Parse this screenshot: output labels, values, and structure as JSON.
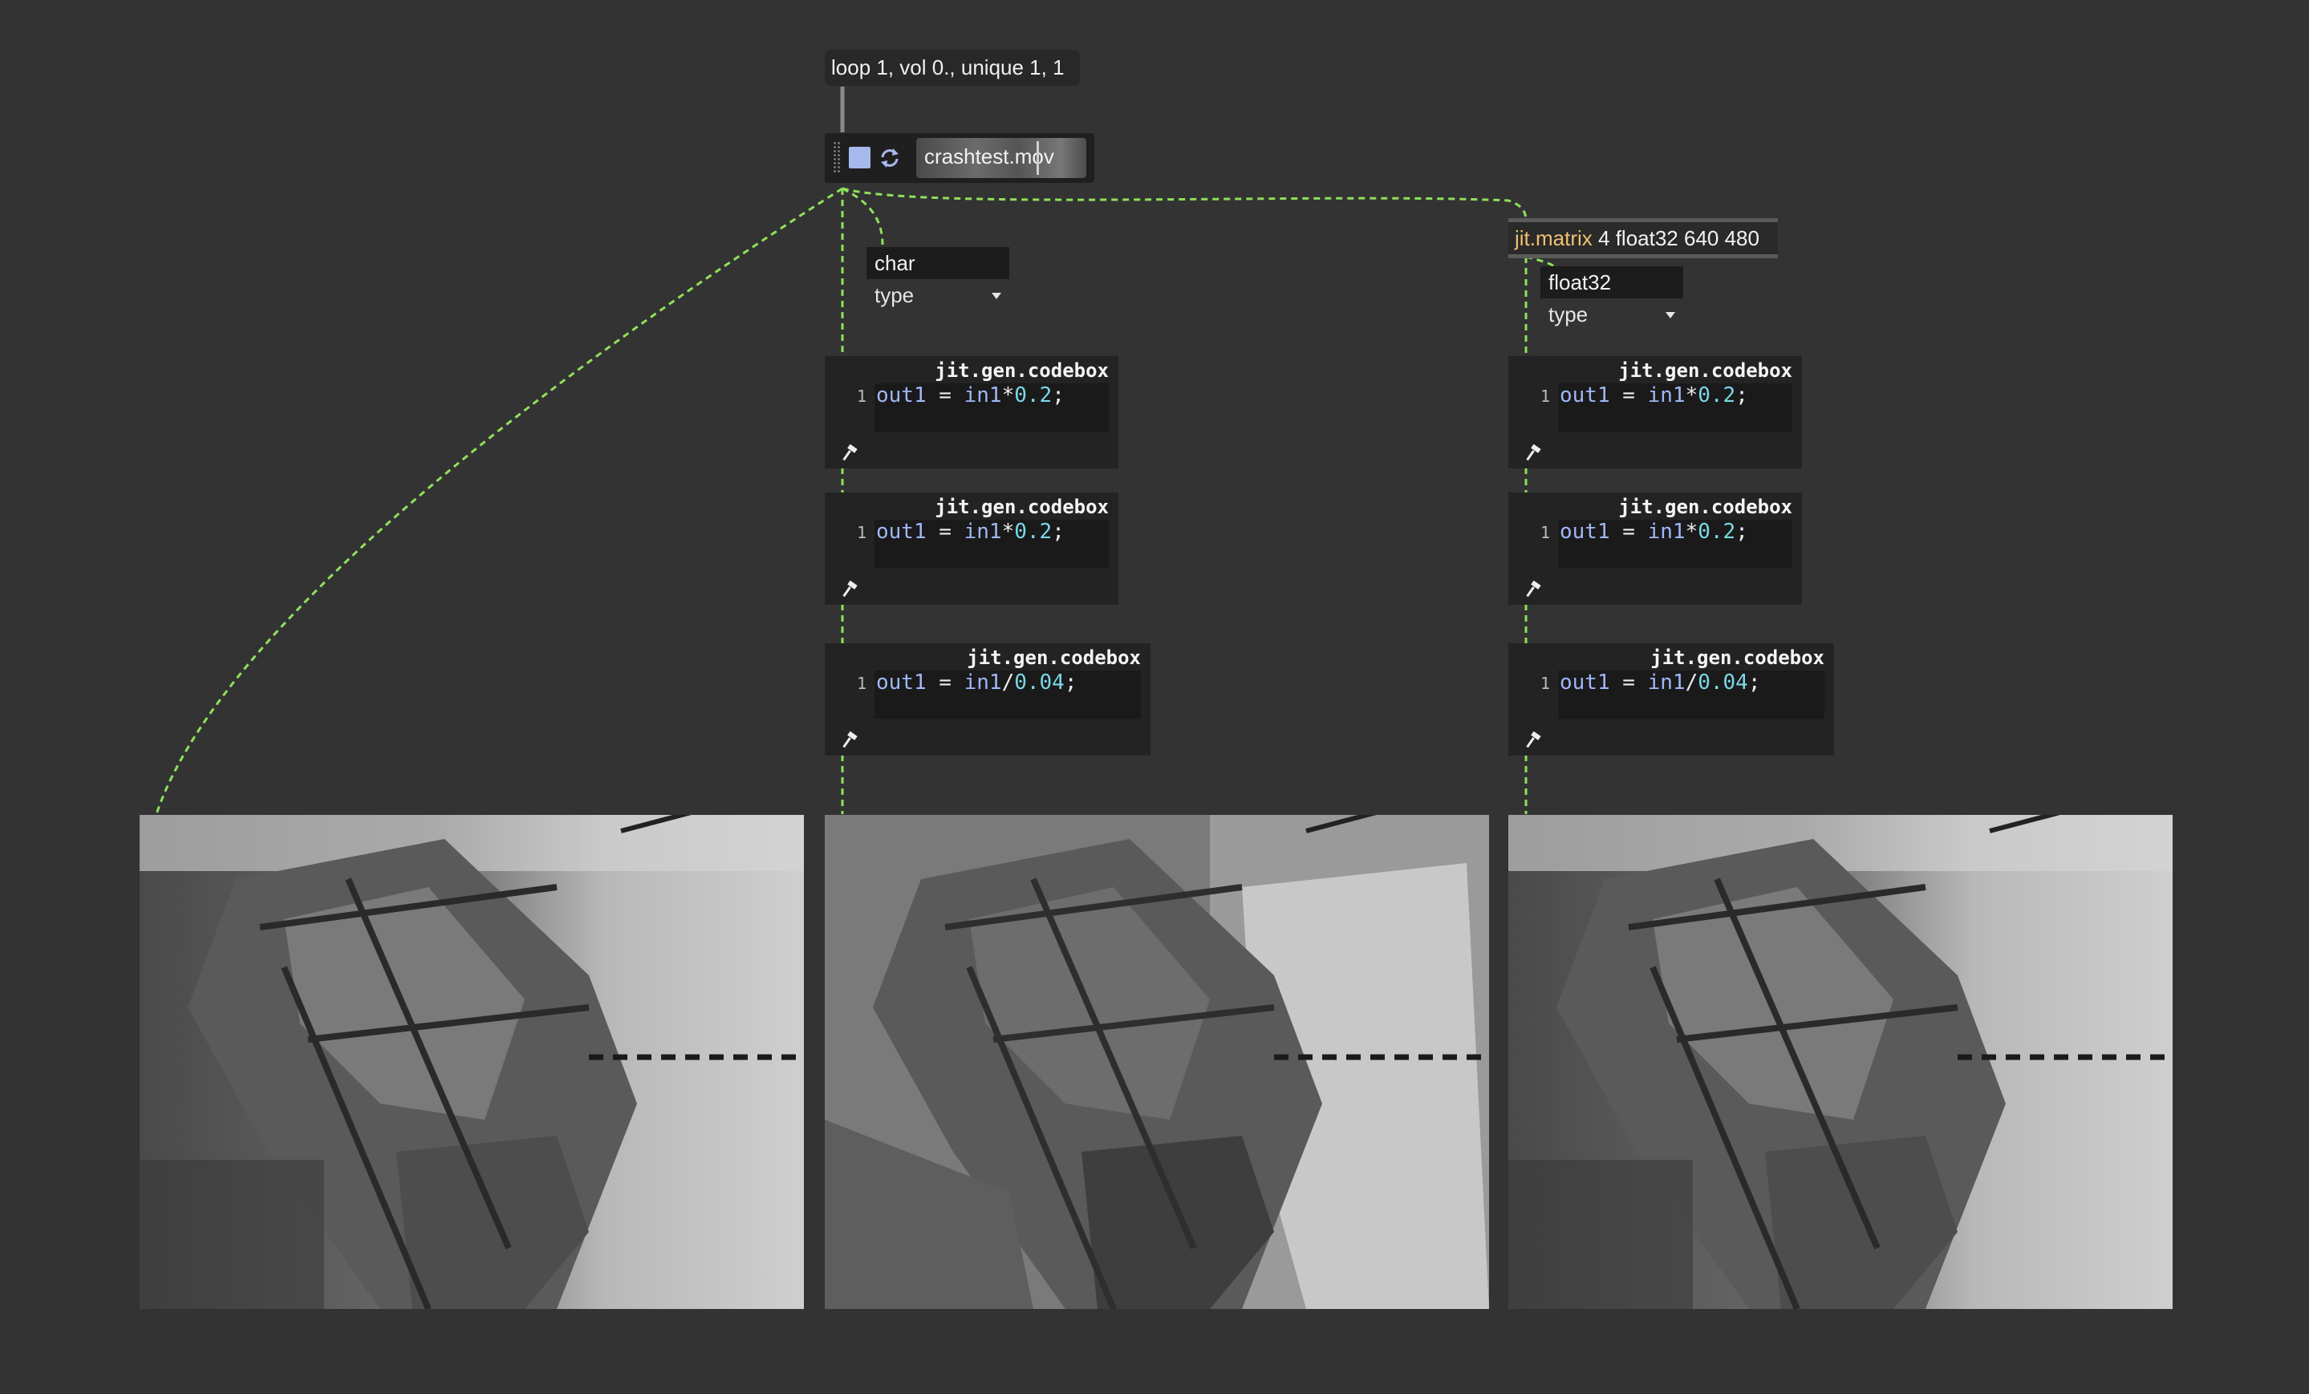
{
  "message_box": {
    "text": "loop 1, vol 0., unique 1, 1"
  },
  "playlist": {
    "clip_name": "crashtest.mov"
  },
  "umenu_left": {
    "value": "char",
    "label": "type"
  },
  "jit_matrix": {
    "class_name": "jit.matrix",
    "args": "4 float32 640 480"
  },
  "umenu_right": {
    "value": "float32",
    "label": "type"
  },
  "codebox_left": [
    {
      "title": "jit.gen.codebox",
      "line_number": "1",
      "var": "out1",
      "op": " = ",
      "input": "in1",
      "operator": "*",
      "number": "0.2",
      "end": ";"
    },
    {
      "title": "jit.gen.codebox",
      "line_number": "1",
      "var": "out1",
      "op": " = ",
      "input": "in1",
      "operator": "*",
      "number": "0.2",
      "end": ";"
    },
    {
      "title": "jit.gen.codebox",
      "line_number": "1",
      "var": "out1",
      "op": " = ",
      "input": "in1",
      "operator": "/",
      "number": "0.04",
      "end": ";"
    }
  ],
  "codebox_right": [
    {
      "title": "jit.gen.codebox",
      "line_number": "1",
      "var": "out1",
      "op": " = ",
      "input": "in1",
      "operator": "*",
      "number": "0.2",
      "end": ";"
    },
    {
      "title": "jit.gen.codebox",
      "line_number": "1",
      "var": "out1",
      "op": " = ",
      "input": "in1",
      "operator": "*",
      "number": "0.2",
      "end": ";"
    },
    {
      "title": "jit.gen.codebox",
      "line_number": "1",
      "var": "out1",
      "op": " = ",
      "input": "in1",
      "operator": "/",
      "number": "0.04",
      "end": ";"
    }
  ],
  "colors": {
    "canvas": "#333333",
    "patch_cord": "#8fe05a",
    "matrix_class": "#f0c070",
    "play_button": "#a7b8ec"
  }
}
